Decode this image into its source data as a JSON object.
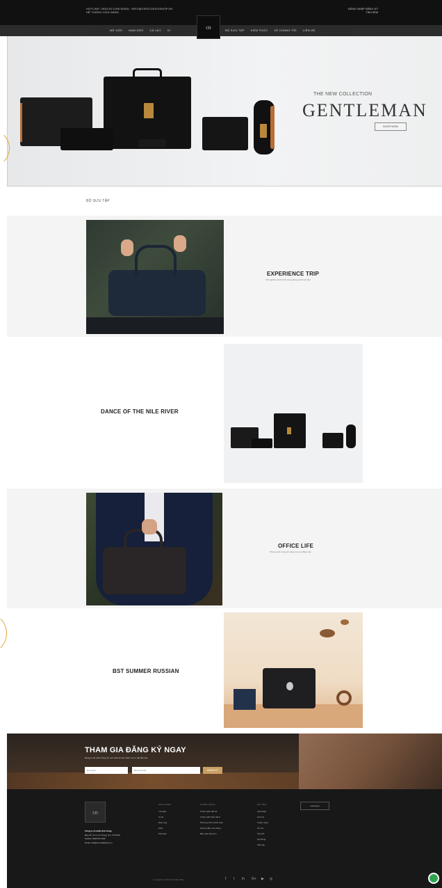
{
  "topbar": {
    "left_line1": "HOTLINE: 0934 52 0196   EMAIL: INFO@CROCODILESHOP.VN",
    "left_line2": "HỆ THỐNG CỬA HÀNG",
    "right_line1": "ĐĂNG NHẬP   ĐĂNG KÝ",
    "right_line2": "TÌM KIẾM"
  },
  "nav": {
    "left_items": [
      "NỮ GIỚI",
      "NAM GIỚI",
      "CÀ VẠT",
      "VÍ"
    ],
    "right_items": [
      "BỘ SƯU TẬP",
      "KIẾN THỨC",
      "VỀ CHÚNG TÔI",
      "LIÊN HỆ"
    ],
    "logo_text": "cn"
  },
  "hero": {
    "subtitle": "THE NEW COLLECTION",
    "title": "GENTLEMAN",
    "button": "SHOP NOW"
  },
  "section_title": "BỘ SƯU TẬP",
  "collections": [
    {
      "title": "EXPERIENCE TRIP",
      "subtitle": "Trải nghiệm hành trình cùng phong cách lịch lãm"
    },
    {
      "title": "DANCE OF THE NILE RIVER",
      "subtitle": ""
    },
    {
      "title": "OFFICE LIFE",
      "subtitle": "Phong cách công sở sang trọng và đẳng cấp"
    },
    {
      "title": "BST SUMMER RUSSIAN",
      "subtitle": ""
    }
  ],
  "newsletter": {
    "title": "THAM GIA ĐĂNG KÝ NGAY",
    "description": "Đăng ký để nhận thông tin mới nhất về sản phẩm và ưu đãi đặc biệt",
    "name_placeholder": "Họ và tên",
    "email_placeholder": "Địa chỉ email",
    "button": "ĐĂNG KÝ"
  },
  "footer": {
    "logo_text": "cn",
    "company": "Công ty cổ phần thời trang",
    "address": "Địa chỉ: 47 Lý Tự Trọng, Q.1, TP.HCM",
    "hotline": "Hotline: 0934 52 0196",
    "email": "Email: info@crocodileshop.vn",
    "col1_title": "SẢN PHẨM",
    "col1": [
      "Túi xách",
      "Ví da",
      "Dây lưng",
      "Giày",
      "Phụ kiện"
    ],
    "col2_title": "CHÍNH SÁCH",
    "col2": [
      "Chính sách đổi trả",
      "Chính sách bảo hành",
      "Phương thức thanh toán",
      "Hướng dẫn mua hàng",
      "Bảo mật thông tin"
    ],
    "col3_title": "HỖ TRỢ",
    "col3": [
      "Giới thiệu",
      "Liên hệ",
      "Tuyển dụng",
      "Tin tức",
      "Câu hỏi",
      "Hệ thống",
      "Sitemap"
    ],
    "fb_button": "Facebook",
    "copyright": "Copyright © 2021 Crocodile Shop",
    "social_icons": [
      "f",
      "t",
      "in",
      "G+",
      "▶",
      "◎"
    ]
  }
}
